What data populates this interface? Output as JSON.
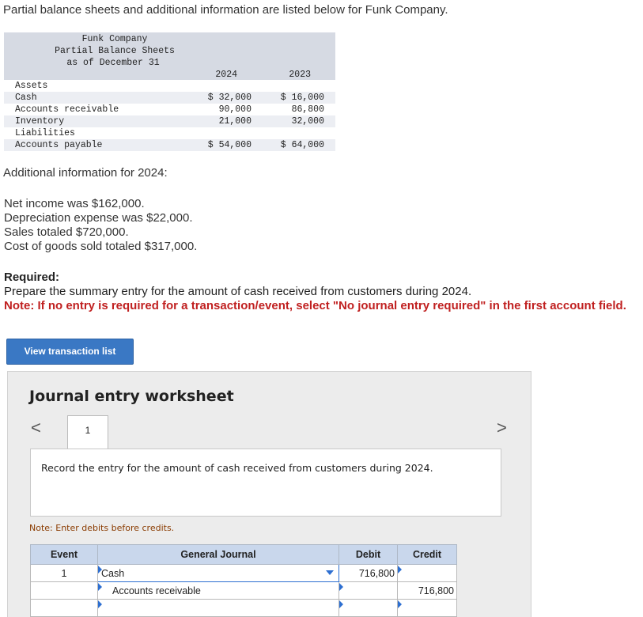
{
  "intro": "Partial balance sheets and additional information are listed below for Funk Company.",
  "balance_sheet": {
    "company": "Funk Company",
    "title": "Partial Balance Sheets",
    "date": "as of December 31",
    "years": [
      "2024",
      "2023"
    ],
    "rows": [
      {
        "label": "Assets",
        "v2024": "",
        "v2023": ""
      },
      {
        "label": "Cash",
        "v2024": "$ 32,000",
        "v2023": "$ 16,000"
      },
      {
        "label": "Accounts receivable",
        "v2024": "90,000",
        "v2023": "86,800"
      },
      {
        "label": "Inventory",
        "v2024": "21,000",
        "v2023": "32,000"
      },
      {
        "label": "Liabilities",
        "v2024": "",
        "v2023": ""
      },
      {
        "label": "Accounts payable",
        "v2024": "$ 54,000",
        "v2023": "$ 64,000"
      }
    ]
  },
  "additional_heading": "Additional information for 2024:",
  "facts": [
    "Net income was $162,000.",
    "Depreciation expense was $22,000.",
    "Sales totaled $720,000.",
    "Cost of goods sold totaled $317,000."
  ],
  "required": {
    "heading": "Required:",
    "text": "Prepare the summary entry for the amount of cash received from customers during 2024.",
    "note": "Note: If no entry is required for a transaction/event, select \"No journal entry required\" in the first account field."
  },
  "view_button": "View transaction list",
  "worksheet": {
    "title": "Journal entry worksheet",
    "prev_icon": "<",
    "next_icon": ">",
    "tab": "1",
    "instruction": "Record the entry for the amount of cash received from customers during 2024.",
    "note": "Note: Enter debits before credits.",
    "headers": {
      "event": "Event",
      "journal": "General Journal",
      "debit": "Debit",
      "credit": "Credit"
    },
    "rows": [
      {
        "event": "1",
        "account": "Cash",
        "debit": "716,800",
        "credit": ""
      },
      {
        "event": "",
        "account": "Accounts receivable",
        "debit": "",
        "credit": "716,800"
      },
      {
        "event": "",
        "account": "",
        "debit": "",
        "credit": ""
      }
    ]
  }
}
